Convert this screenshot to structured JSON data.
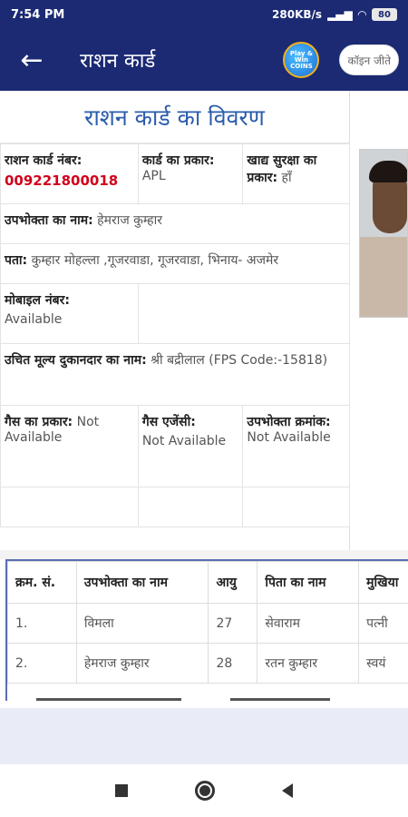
{
  "status_bar": {
    "time": "7:54 PM",
    "network": "280KB/s",
    "battery": "80"
  },
  "app_bar": {
    "title": "राशन कार्ड",
    "coins_badge": "Play & Win COINS",
    "coin_button": "कॉइन जीते"
  },
  "card": {
    "heading": "राशन कार्ड का विवरण",
    "number_label": "राशन कार्ड नंबर:",
    "number_value": "009221800018",
    "type_label": "कार्ड का प्रकार:",
    "type_value": "APL",
    "food_security_label": "खाद्य सुरक्षा का प्रकार:",
    "food_security_value": "हाँ",
    "consumer_name_label": "उपभोक्ता का नाम:",
    "consumer_name_value": "हेमराज कुम्हार",
    "address_label": "पता:",
    "address_value": "कुम्हार मोहल्ला ,गूजरवाडा, गूजरवाडा, भिनाय- अजमेर",
    "mobile_label": "मोबाइल नंबर:",
    "mobile_value": "Available",
    "fps_label": "उचित मूल्य दुकानदार का नाम:",
    "fps_value": "श्री बद्रीलाल (FPS Code:-15818)",
    "gas_type_label": "गैस का प्रकार:",
    "gas_type_value": "Not Available",
    "gas_agency_label": "गैस एजेंसी:",
    "gas_agency_value": "Not Available",
    "consumer_no_label": "उपभोक्ता क्रमांक:",
    "consumer_no_value": "Not Available"
  },
  "members": {
    "headers": [
      "क्रम. सं.",
      "उपभोक्ता का नाम",
      "आयु",
      "पिता का नाम",
      "मुखिया"
    ],
    "rows": [
      [
        "1.",
        "विमला",
        "27",
        "सेवाराम",
        "पत्नी"
      ],
      [
        "2.",
        "हेमराज कुम्हार",
        "28",
        "रतन कुम्हार",
        "स्वयं"
      ]
    ]
  },
  "colors": {
    "appbar": "#1b2a73",
    "heading": "#2b5cab",
    "card_number": "#d0021b"
  }
}
